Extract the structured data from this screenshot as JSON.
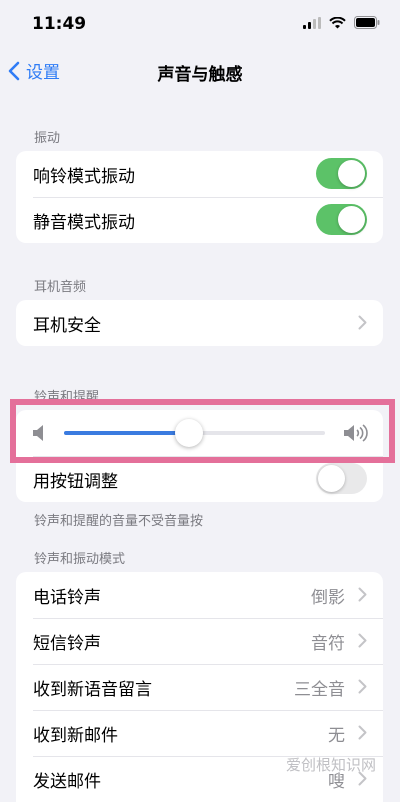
{
  "status": {
    "time": "11:49"
  },
  "nav": {
    "back_label": "设置",
    "title": "声音与触感"
  },
  "sections": {
    "vibration": {
      "header": "振动",
      "rows": [
        {
          "label": "响铃模式振动",
          "toggle_on": true
        },
        {
          "label": "静音模式振动",
          "toggle_on": true
        }
      ]
    },
    "headphone": {
      "header": "耳机音频",
      "rows": [
        {
          "label": "耳机安全"
        }
      ]
    },
    "ringer": {
      "header": "铃声和提醒",
      "volume_level": 0.48,
      "adjust_label": "用按钮调整",
      "adjust_on": false,
      "footer": "铃声和提醒的音量不受音量按"
    },
    "patterns": {
      "header": "铃声和振动模式",
      "rows": [
        {
          "label": "电话铃声",
          "value": "倒影"
        },
        {
          "label": "短信铃声",
          "value": "音符"
        },
        {
          "label": "收到新语音留言",
          "value": "三全音"
        },
        {
          "label": "收到新邮件",
          "value": "无"
        },
        {
          "label": "发送邮件",
          "value": "嗖"
        }
      ]
    }
  },
  "watermark": "爱创根知识网",
  "colors": {
    "accent": "#2f7cf6",
    "toggle_on": "#5cc268",
    "highlight": "#e4709a"
  }
}
